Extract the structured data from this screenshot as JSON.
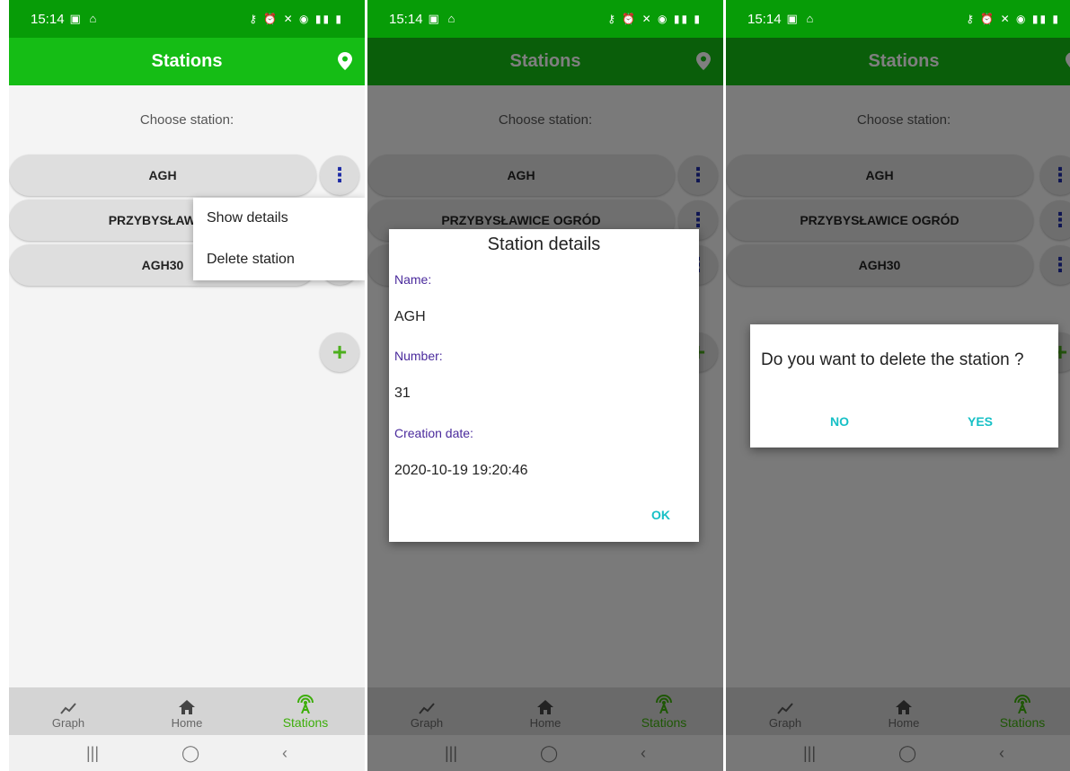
{
  "status": {
    "time": "15:14"
  },
  "appbar": {
    "title": "Stations"
  },
  "content": {
    "prompt": "Choose station:",
    "stations": [
      {
        "label": "AGH"
      },
      {
        "label": "PRZYBYSŁAWICE OGRÓD"
      },
      {
        "label": "AGH30"
      }
    ],
    "stations_truncated_s1": [
      "AGH",
      "PRZYBYSŁAWICE",
      "AGH30"
    ]
  },
  "menu": {
    "items": [
      "Show details",
      "Delete station"
    ]
  },
  "details_dialog": {
    "title": "Station details",
    "name_label": "Name:",
    "name_value": "AGH",
    "number_label": "Number:",
    "number_value": "31",
    "date_label": "Creation date:",
    "date_value": "2020-10-19 19:20:46",
    "ok_label": "OK"
  },
  "confirm_dialog": {
    "question": "Do you want to delete the station ?",
    "no_label": "NO",
    "yes_label": "YES"
  },
  "bottom_nav": [
    {
      "label": "Graph",
      "icon": "graph-icon"
    },
    {
      "label": "Home",
      "icon": "home-icon"
    },
    {
      "label": "Stations",
      "icon": "antenna-icon",
      "active": true
    }
  ],
  "colors": {
    "status_bar": "#079c07",
    "app_bar": "#15bd15",
    "accent": "#17c0c6",
    "active_nav": "#3dae0a"
  }
}
